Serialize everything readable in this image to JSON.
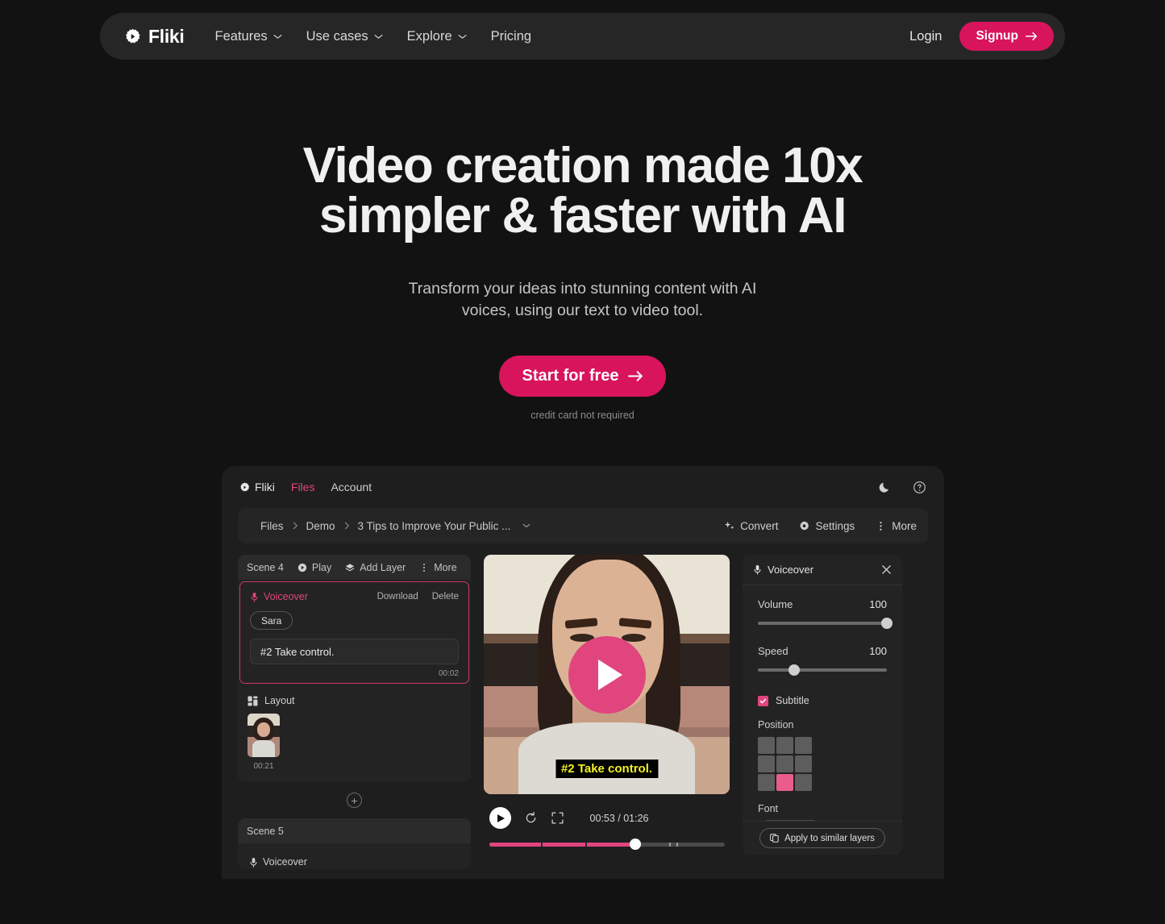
{
  "nav": {
    "brand": "Fliki",
    "brand_logo_icon": "gear-play-icon",
    "links": [
      {
        "label": "Features",
        "has_chevron": true
      },
      {
        "label": "Use cases",
        "has_chevron": true
      },
      {
        "label": "Explore",
        "has_chevron": true
      },
      {
        "label": "Pricing",
        "has_chevron": false
      }
    ],
    "login_label": "Login",
    "signup_label": "Signup",
    "signup_color": "#D8145C"
  },
  "hero": {
    "title_line1": "Video creation made 10x",
    "title_line2": "simpler & faster with AI",
    "sub_line1": "Transform your ideas into stunning content with AI",
    "sub_line2": "voices, using our text to video tool.",
    "cta_label": "Start for free",
    "cta_note": "credit card not required",
    "cta_color": "#D8145C"
  },
  "app": {
    "header": {
      "brand": "Fliki",
      "tabs": [
        {
          "label": "Files",
          "active": true
        },
        {
          "label": "Account",
          "active": false
        }
      ],
      "dark_mode_icon": "moon-icon",
      "help_icon": "question-circle-icon",
      "active_color": "#E0457E"
    },
    "toolbar": {
      "breadcrumbs": [
        "Files",
        "Demo",
        "3 Tips to Improve Your Public ..."
      ],
      "actions": [
        {
          "label": "Convert",
          "icon": "sparkle-icon"
        },
        {
          "label": "Settings",
          "icon": "gear-icon"
        },
        {
          "label": "More",
          "icon": "dots-vertical-icon"
        }
      ]
    },
    "scene_panel": {
      "scene4": {
        "title": "Scene 4",
        "play_label": "Play",
        "add_layer_label": "Add Layer",
        "more_label": "More",
        "voiceover": {
          "label": "Voiceover",
          "download_label": "Download",
          "delete_label": "Delete",
          "voice_name": "Sara",
          "text": "#2 Take control.",
          "duration": "00:02"
        },
        "layout": {
          "label": "Layout",
          "duration": "00:21"
        }
      },
      "add_scene_icon": "plus-circle-icon",
      "scene5": {
        "title": "Scene 5",
        "voiceover_label": "Voiceover"
      }
    },
    "player": {
      "subtitle_text": "#2 Take control.",
      "subtitle_color": "#F2F221",
      "play_overlay_color": "#E0457E",
      "play_icon": "play-icon",
      "loop_icon": "restart-icon",
      "fullscreen_icon": "fullscreen-icon",
      "current_time": "00:53",
      "total_time": "01:26",
      "time_display": "00:53 / 01:26",
      "progress_percent": 62
    },
    "right_panel": {
      "title": "Voiceover",
      "title_icon": "microphone-icon",
      "close_icon": "close-icon",
      "volume": {
        "label": "Volume",
        "value": 100,
        "percent": 100
      },
      "speed": {
        "label": "Speed",
        "value": 100,
        "percent": 28
      },
      "subtitle": {
        "label": "Subtitle",
        "checked": true
      },
      "position": {
        "label": "Position",
        "selected_index": 7,
        "selected_color": "#E95C8E"
      },
      "font": {
        "label": "Font"
      },
      "apply_button": {
        "label": "Apply to similar layers",
        "icon": "copy-icon"
      }
    }
  }
}
